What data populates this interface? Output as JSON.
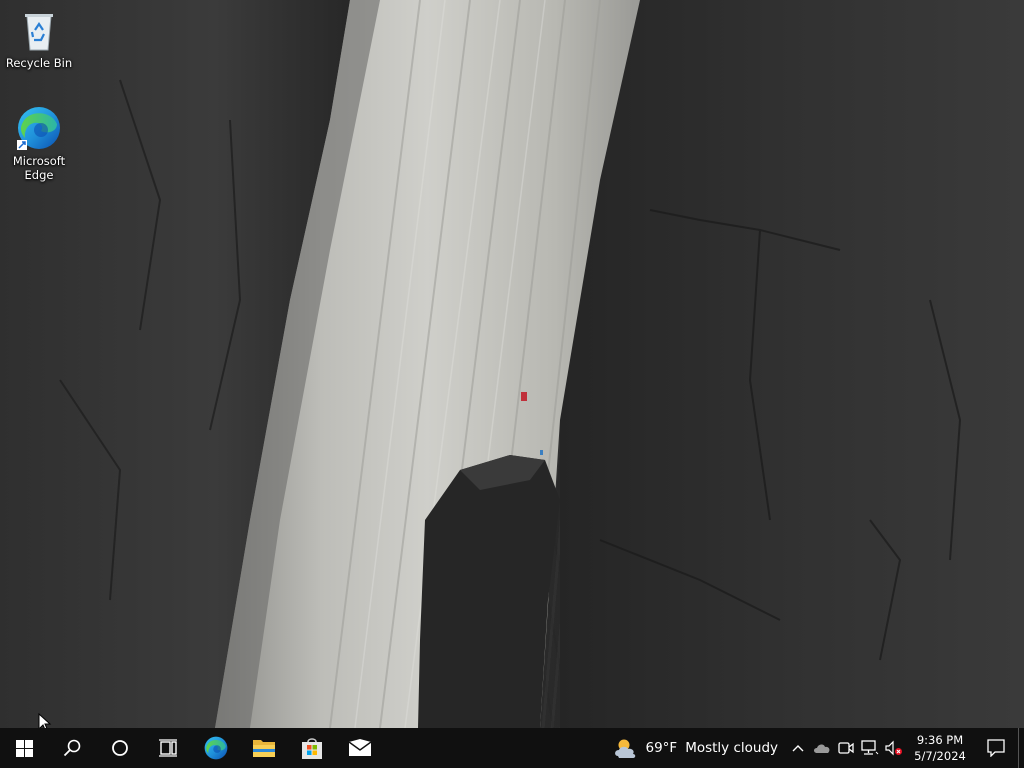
{
  "desktop": {
    "icons": [
      {
        "label": "Recycle Bin",
        "icon": "recycle-bin-icon"
      },
      {
        "label": "Microsoft\nEdge",
        "icon": "edge-icon"
      }
    ]
  },
  "taskbar": {
    "pinned": [
      {
        "name": "start",
        "icon": "windows-logo-icon"
      },
      {
        "name": "search",
        "icon": "search-icon"
      },
      {
        "name": "cortana",
        "icon": "cortana-circle-icon"
      },
      {
        "name": "task-view",
        "icon": "task-view-icon"
      },
      {
        "name": "edge",
        "icon": "edge-icon"
      },
      {
        "name": "file-explorer",
        "icon": "folder-icon"
      },
      {
        "name": "store",
        "icon": "store-bag-icon"
      },
      {
        "name": "mail",
        "icon": "mail-icon"
      }
    ],
    "weather": {
      "temp": "69°F",
      "condition": "Mostly cloudy",
      "icon": "partly-cloudy-icon"
    },
    "tray_icons": [
      "chevron-up-icon",
      "onedrive-cloud-icon",
      "meet-now-icon",
      "network-icon",
      "volume-muted-icon"
    ],
    "clock": {
      "time": "9:36 PM",
      "date": "5/7/2024"
    },
    "colors": {
      "taskbar_bg": "#101010",
      "accent": "#0078d7"
    }
  }
}
